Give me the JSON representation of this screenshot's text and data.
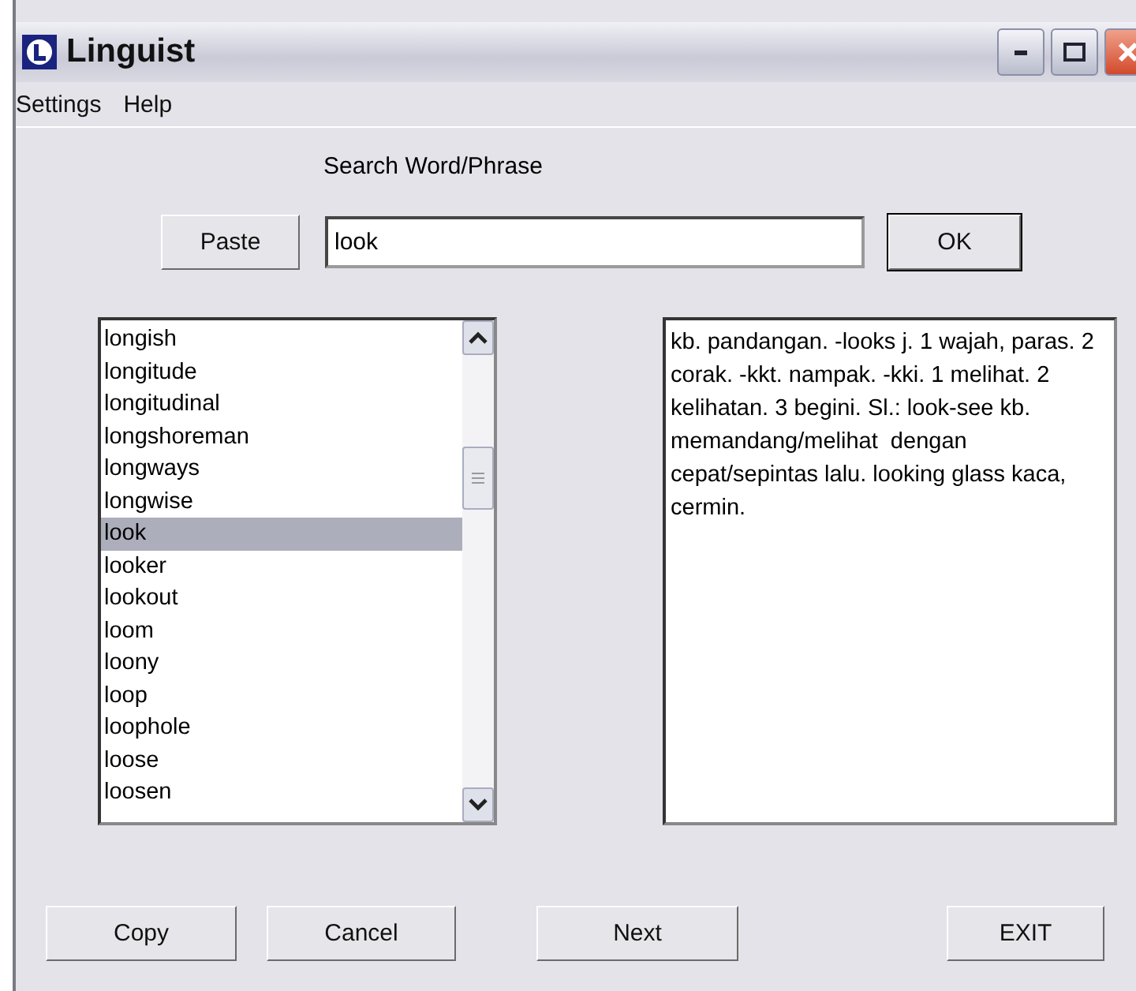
{
  "window": {
    "title": "Linguist"
  },
  "menu": [
    "Settings",
    "Help"
  ],
  "search": {
    "label": "Search Word/Phrase",
    "value": "look"
  },
  "paste_button": "Paste",
  "ok_button": "OK",
  "words": [
    {
      "text": "longish",
      "selected": false
    },
    {
      "text": "longitude",
      "selected": false
    },
    {
      "text": "longitudinal",
      "selected": false
    },
    {
      "text": "longshoreman",
      "selected": false
    },
    {
      "text": "longways",
      "selected": false
    },
    {
      "text": "longwise",
      "selected": false
    },
    {
      "text": "look",
      "selected": true
    },
    {
      "text": "looker",
      "selected": false
    },
    {
      "text": "lookout",
      "selected": false
    },
    {
      "text": "loom",
      "selected": false
    },
    {
      "text": "loony",
      "selected": false
    },
    {
      "text": "loop",
      "selected": false
    },
    {
      "text": "loophole",
      "selected": false
    },
    {
      "text": "loose",
      "selected": false
    },
    {
      "text": "loosen",
      "selected": false
    }
  ],
  "definition": "kb. pandangan. -looks j. 1 wajah, paras. 2 corak. -kkt. nampak. -kki. 1 melihat. 2 kelihatan. 3 begini. Sl.: look-see kb. memandang/melihat  dengan cepat/sepintas lalu. looking glass kaca, cermin.",
  "buttons": [
    "Copy",
    "Cancel",
    "Next",
    "EXIT"
  ]
}
